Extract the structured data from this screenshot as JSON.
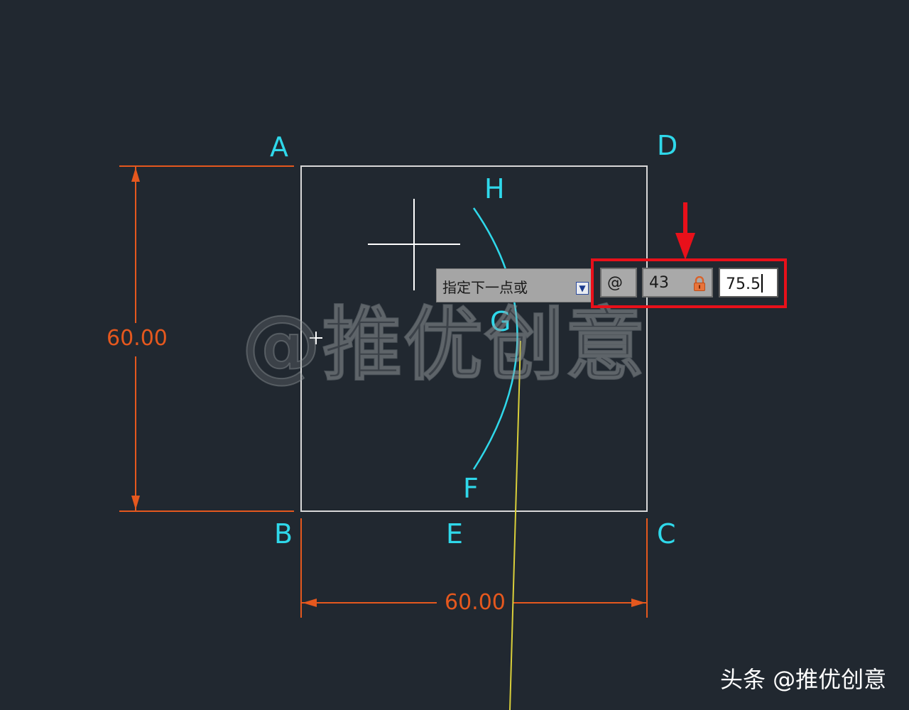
{
  "points": {
    "A": "A",
    "B": "B",
    "C": "C",
    "D": "D",
    "E": "E",
    "F": "F",
    "G": "G",
    "H": "H"
  },
  "dimensions": {
    "vertical": "60.00",
    "horizontal": "60.00"
  },
  "watermark": "@推优创意",
  "command_prompt": {
    "text": "指定下一点或",
    "icon": "dropdown-icon"
  },
  "dynamic_input": {
    "prefix": "@",
    "length": "43",
    "angle": "75.5",
    "length_icon": "lock-icon"
  },
  "footer": "头条 @推优创意",
  "colors": {
    "background": "#212830",
    "geometry": "#d8d8d8",
    "labels": "#2fd8ea",
    "dimensions": "#e5581e",
    "guide": "#d9cf3a",
    "highlight": "#e8101a"
  }
}
